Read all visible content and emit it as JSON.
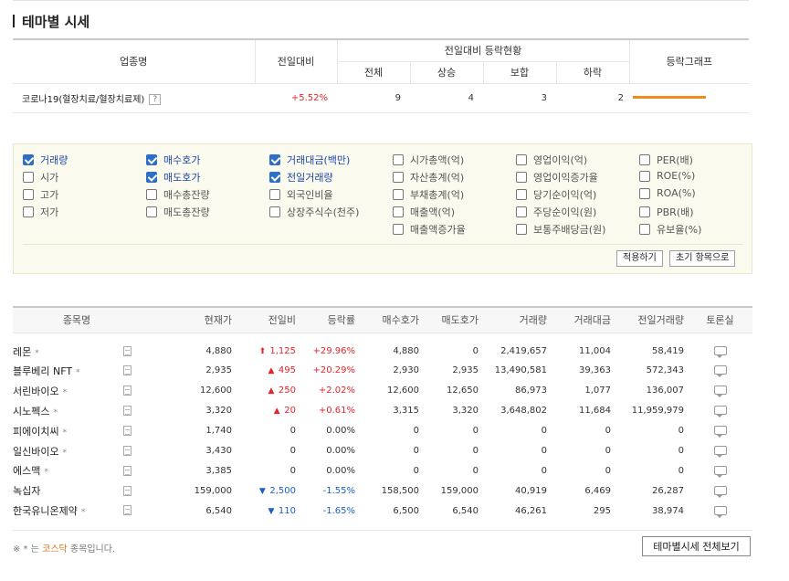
{
  "title": "테마별 시세",
  "summary": {
    "headers": {
      "sector": "업종명",
      "change": "전일대비",
      "status_group": "전일대비 등락현황",
      "total": "전체",
      "up": "상승",
      "flat": "보합",
      "down": "하락",
      "graph": "등락그래프"
    },
    "row": {
      "name": "코로나19(혈장치료/혈장치료제)",
      "help": "?",
      "change": "+5.52%",
      "total": "9",
      "up": "4",
      "flat": "3",
      "down": "2",
      "rate_bar_fraction": 0.5
    }
  },
  "options": {
    "items": [
      {
        "label": "거래량",
        "checked": true
      },
      {
        "label": "시가",
        "checked": false
      },
      {
        "label": "고가",
        "checked": false
      },
      {
        "label": "저가",
        "checked": false
      },
      {
        "label": "매수호가",
        "checked": true
      },
      {
        "label": "매도호가",
        "checked": true
      },
      {
        "label": "매수총잔량",
        "checked": false
      },
      {
        "label": "매도총잔량",
        "checked": false
      },
      {
        "label": "거래대금(백만)",
        "checked": true
      },
      {
        "label": "전일거래량",
        "checked": true
      },
      {
        "label": "외국인비율",
        "checked": false
      },
      {
        "label": "상장주식수(천주)",
        "checked": false
      },
      {
        "label": "시가총액(억)",
        "checked": false
      },
      {
        "label": "자산총계(억)",
        "checked": false
      },
      {
        "label": "부채총계(억)",
        "checked": false
      },
      {
        "label": "매출액(억)",
        "checked": false
      },
      {
        "label": "매출액증가율",
        "checked": false
      },
      {
        "label": "영업이익(억)",
        "checked": false
      },
      {
        "label": "영업이익증가율",
        "checked": false
      },
      {
        "label": "당기순이익(억)",
        "checked": false
      },
      {
        "label": "주당순이익(원)",
        "checked": false
      },
      {
        "label": "보통주배당금(원)",
        "checked": false
      },
      {
        "label": "PER(배)",
        "checked": false
      },
      {
        "label": "ROE(%)",
        "checked": false
      },
      {
        "label": "ROA(%)",
        "checked": false
      },
      {
        "label": "PBR(배)",
        "checked": false
      },
      {
        "label": "유보율(%)",
        "checked": false
      }
    ],
    "apply_label": "적용하기",
    "reset_label": "초기 항목으로"
  },
  "stocks": {
    "headers": [
      "종목명",
      "현재가",
      "전일비",
      "등락률",
      "매수호가",
      "매도호가",
      "거래량",
      "거래대금",
      "전일거래량",
      "토론실"
    ],
    "rows": [
      {
        "name": "레몬",
        "kosdaq": true,
        "price": "4,880",
        "dir": "upper",
        "diff": "1,125",
        "rate": "+29.96%",
        "bid": "4,880",
        "ask": "0",
        "volume": "2,419,657",
        "amount": "11,004",
        "prev_volume": "58,419"
      },
      {
        "name": "블루베리 NFT",
        "kosdaq": true,
        "price": "2,935",
        "dir": "up",
        "diff": "495",
        "rate": "+20.29%",
        "bid": "2,930",
        "ask": "2,935",
        "volume": "13,490,581",
        "amount": "39,363",
        "prev_volume": "572,343"
      },
      {
        "name": "서린바이오",
        "kosdaq": true,
        "price": "12,600",
        "dir": "up",
        "diff": "250",
        "rate": "+2.02%",
        "bid": "12,600",
        "ask": "12,650",
        "volume": "86,973",
        "amount": "1,077",
        "prev_volume": "136,007"
      },
      {
        "name": "시노펙스",
        "kosdaq": true,
        "price": "3,320",
        "dir": "up",
        "diff": "20",
        "rate": "+0.61%",
        "bid": "3,315",
        "ask": "3,320",
        "volume": "3,648,802",
        "amount": "11,684",
        "prev_volume": "11,959,979"
      },
      {
        "name": "피에이치씨",
        "kosdaq": true,
        "price": "1,740",
        "dir": "none",
        "diff": "0",
        "rate": "0.00%",
        "bid": "0",
        "ask": "0",
        "volume": "0",
        "amount": "0",
        "prev_volume": "0"
      },
      {
        "name": "일신바이오",
        "kosdaq": true,
        "price": "3,430",
        "dir": "none",
        "diff": "0",
        "rate": "0.00%",
        "bid": "0",
        "ask": "0",
        "volume": "0",
        "amount": "0",
        "prev_volume": "0"
      },
      {
        "name": "에스맥",
        "kosdaq": true,
        "price": "3,385",
        "dir": "none",
        "diff": "0",
        "rate": "0.00%",
        "bid": "0",
        "ask": "0",
        "volume": "0",
        "amount": "0",
        "prev_volume": "0"
      },
      {
        "name": "녹십자",
        "kosdaq": false,
        "price": "159,000",
        "dir": "down",
        "diff": "2,500",
        "rate": "-1.55%",
        "bid": "158,500",
        "ask": "159,000",
        "volume": "40,919",
        "amount": "6,469",
        "prev_volume": "26,287"
      },
      {
        "name": "한국유니온제약",
        "kosdaq": true,
        "price": "6,540",
        "dir": "down",
        "diff": "110",
        "rate": "-1.65%",
        "bid": "6,500",
        "ask": "6,540",
        "volume": "46,261",
        "amount": "295",
        "prev_volume": "38,974"
      }
    ]
  },
  "footer": {
    "note_prefix": "※ * 는 ",
    "note_kosdaq": "코스닥",
    "note_suffix": " 종목입니다.",
    "all_button": "테마별시세 전체보기"
  },
  "star": "*",
  "colors": {
    "rise": "#e8242b",
    "fall": "#1a5fc6",
    "kosdaq": "#d8701b",
    "bar": "#f08a1b"
  }
}
